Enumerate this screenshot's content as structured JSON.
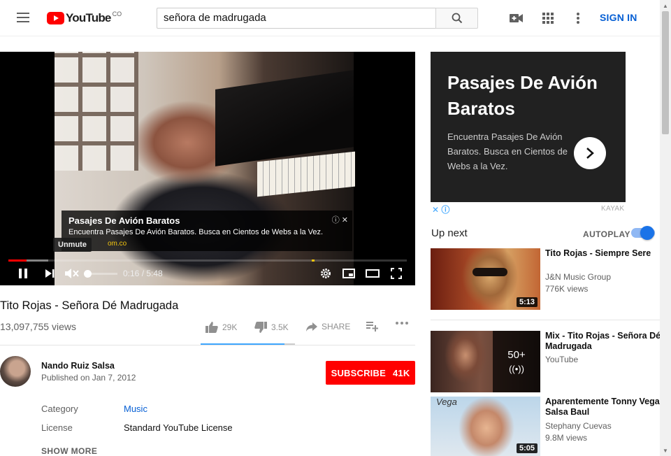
{
  "header": {
    "logo_text": "YouTube",
    "logo_country": "CO",
    "search_value": "señora de madrugada",
    "signin_label": "SIGN IN"
  },
  "player": {
    "ad_title": "Pasajes De Avión Baratos",
    "ad_desc": "Encuentra Pasajes De Avión Baratos. Busca en Cientos de Webs a la Vez.",
    "ad_url": "om.co",
    "tooltip": "Unmute",
    "time": "0:16 / 5:48",
    "progress_played": 0.045,
    "progress_loaded": 0.1,
    "volume_level": 0
  },
  "ad_card": {
    "title": "Pasajes De Avión Baratos",
    "desc": "Encuentra Pasajes De Avión Baratos. Busca en Cientos de Webs a la Vez.",
    "brand": "KAYAK"
  },
  "video": {
    "title": "Tito Rojas - Señora Dé Madrugada",
    "views": "13,097,755 views",
    "likes": "29K",
    "dislikes": "3.5K",
    "share_label": "SHARE",
    "like_ratio": 0.89,
    "channel": "Nando Ruiz Salsa",
    "published": "Published on Jan 7, 2012",
    "subscribe_label": "SUBSCRIBE",
    "subscribe_count": "41K",
    "meta": [
      {
        "key": "Category",
        "value": "Music"
      },
      {
        "key": "License",
        "value": "Standard YouTube License"
      }
    ],
    "show_more": "SHOW MORE"
  },
  "sidebar": {
    "up_next": "Up next",
    "autoplay": "AUTOPLAY",
    "autoplay_on": true,
    "items": [
      {
        "title": "Tito Rojas - Siempre Sere",
        "channel": "J&N Music Group",
        "views": "776K views",
        "duration": "5:13"
      },
      {
        "title": "Mix - Tito Rojas - Señora Dé Madrugada",
        "channel": "YouTube",
        "views": "",
        "duration": "",
        "mix_count": "50+"
      },
      {
        "title": "Aparentemente Tonny Vega Salsa Baul",
        "channel": "Stephany Cuevas",
        "views": "9.8M views",
        "duration": "5:05",
        "thumb_text": "Vega"
      }
    ]
  },
  "colors": {
    "brand_red": "#ff0000",
    "link_blue": "#065fd4",
    "ad_bg": "#212121"
  }
}
